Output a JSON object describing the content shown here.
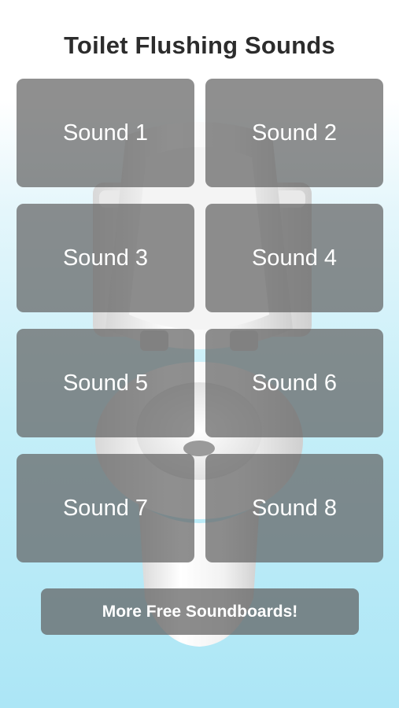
{
  "header": {
    "title": "Toilet Flushing Sounds"
  },
  "sounds": [
    {
      "label": "Sound 1"
    },
    {
      "label": "Sound 2"
    },
    {
      "label": "Sound 3"
    },
    {
      "label": "Sound 4"
    },
    {
      "label": "Sound 5"
    },
    {
      "label": "Sound 6"
    },
    {
      "label": "Sound 7"
    },
    {
      "label": "Sound 8"
    }
  ],
  "footer": {
    "more_label": "More Free Soundboards!"
  },
  "colors": {
    "button_fill": "#606060",
    "button_text": "#ffffff",
    "title_text": "#2c2c2c",
    "background_bottom": "#ace6f6"
  },
  "background_image": {
    "icon": "toilet-icon"
  }
}
